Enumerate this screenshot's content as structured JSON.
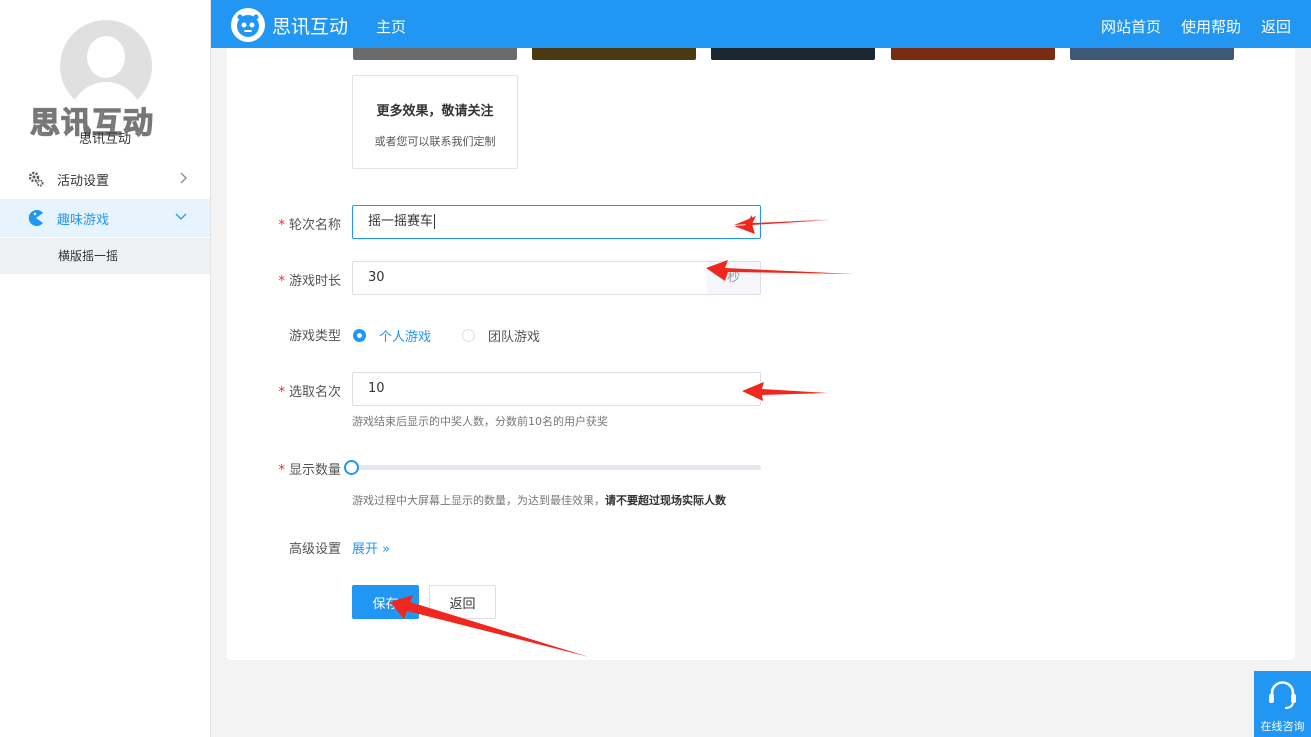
{
  "sidebar": {
    "logo_text": "思讯互动",
    "org_name": "思讯互动",
    "items": [
      {
        "label": "活动设置"
      },
      {
        "label": "趣味游戏"
      }
    ],
    "sub_items": [
      {
        "label": "横版摇一摇"
      }
    ]
  },
  "header": {
    "brand": "思讯互动",
    "home": "主页",
    "links": [
      "网站首页",
      "使用帮助",
      "返回"
    ]
  },
  "more_box": {
    "title": "更多效果，敬请关注",
    "subtitle": "或者您可以联系我们定制"
  },
  "form": {
    "round_name": {
      "label": "轮次名称",
      "value": "摇一摇赛车"
    },
    "duration": {
      "label": "游戏时长",
      "value": "30",
      "unit": "秒"
    },
    "game_type": {
      "label": "游戏类型",
      "options": [
        "个人游戏",
        "团队游戏"
      ],
      "selected": "个人游戏"
    },
    "rank": {
      "label": "选取名次",
      "value": "10",
      "hint": "游戏结束后显示的中奖人数，分数前10名的用户获奖"
    },
    "display_count": {
      "label": "显示数量",
      "hint_prefix": "游戏过程中大屏幕上显示的数量，为达到最佳效果，",
      "hint_bold": "请不要超过现场实际人数",
      "value_fraction": 0
    },
    "advanced": {
      "label": "高级设置",
      "link": "展开 »"
    }
  },
  "buttons": {
    "save": "保存",
    "back": "返回"
  },
  "consult": {
    "label": "在线咨询"
  },
  "colors": {
    "accent": "#2196f3",
    "required": "#f5222d",
    "annotation_arrow": "#f0271f"
  }
}
